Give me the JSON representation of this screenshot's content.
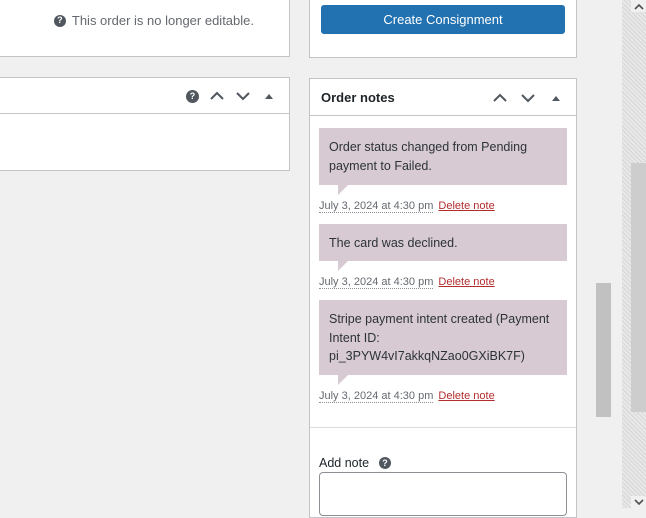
{
  "order_status": {
    "not_editable_text": "This order is no longer editable."
  },
  "actions": {
    "create_consignment_label": "Create Consignment"
  },
  "order_notes": {
    "title": "Order notes",
    "notes": [
      {
        "content": "Order status changed from Pending payment to Failed.",
        "date": "July 3, 2024 at 4:30 pm",
        "delete_label": "Delete note"
      },
      {
        "content": "The card was declined.",
        "date": "July 3, 2024 at 4:30 pm",
        "delete_label": "Delete note"
      },
      {
        "content": "Stripe payment intent created (Payment Intent ID: pi_3PYW4vI7akkqNZao0GXiBK7F)",
        "date": "July 3, 2024 at 4:30 pm",
        "delete_label": "Delete note"
      }
    ],
    "add_note_label": "Add note"
  },
  "icons": {
    "help": "help-icon",
    "move_up": "chevron-up-icon",
    "move_down": "chevron-down-icon",
    "toggle": "triangle-up-icon"
  },
  "colors": {
    "primary_button": "#2271b1",
    "note_bubble": "#d7cad2",
    "delete_link": "#b32d2e"
  }
}
